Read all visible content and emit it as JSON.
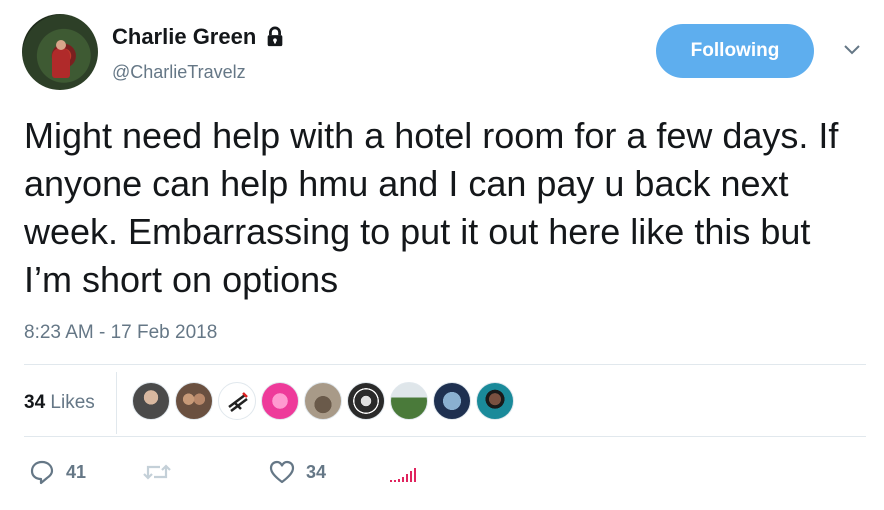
{
  "user": {
    "display_name": "Charlie Green",
    "handle": "@CharlieTravelz",
    "protected_icon": "lock-icon",
    "avatar_icon": "profile-photo"
  },
  "follow_button": {
    "label": "Following",
    "color": "#5eaeee"
  },
  "more_menu_icon": "chevron-down-icon",
  "tweet": {
    "text": "Might need help with a hotel room for a few days. If anyone can help hmu and I can pay u back next week. Embarrassing to put it out here like this but I’m short on options",
    "timestamp": "8:23 AM - 17 Feb 2018"
  },
  "stats": {
    "likes_count": "34",
    "likes_label": "Likes",
    "likers": [
      {
        "color": "#5a5a5a"
      },
      {
        "color": "#a07a5a"
      },
      {
        "color": "#ffffff"
      },
      {
        "color": "#ee3a9a"
      },
      {
        "color": "#8a7a6a"
      },
      {
        "color": "#2a2a2a"
      },
      {
        "color": "#4a6a3a"
      },
      {
        "color": "#3a5a7a"
      },
      {
        "color": "#1a8a9a"
      }
    ]
  },
  "actions": {
    "reply_count": "41",
    "retweet_count": "",
    "like_count": "34",
    "reply_icon": "reply-icon",
    "retweet_icon": "retweet-icon",
    "like_icon": "heart-icon",
    "analytics_icon": "analytics-icon"
  }
}
